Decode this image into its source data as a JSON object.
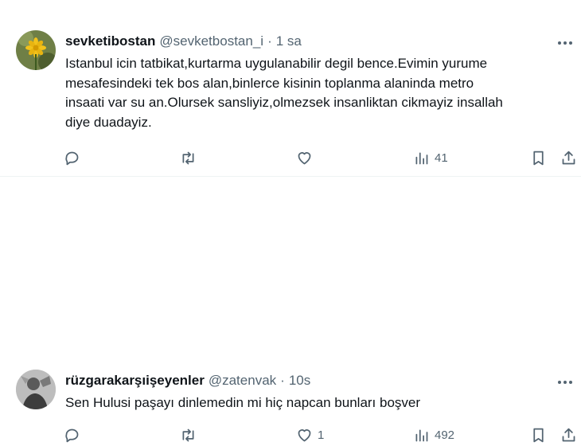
{
  "tweets": [
    {
      "display_name": "sevketibostan",
      "handle": "@sevketbostan_i",
      "sep": "·",
      "time": "1 sa",
      "lines": [
        "Istanbul icin tatbikat,kurtarma uygulanabilir degil bence.Evimin yurume",
        "mesafesindeki tek bos alan,binlerce kisinin toplanma alaninda metro",
        "insaati var su an.Olursek sansliyiz,olmezsek insanliktan cikmayiz insallah",
        "diye duadayiz."
      ],
      "likes": "",
      "views": "41"
    },
    {
      "display_name": "rüzgarakarşıişeyenler",
      "handle": "@zatenvak",
      "sep": "·",
      "time": "10s",
      "lines": [
        "Sen Hulusi paşayı dinlemedin mi hiç napcan bunları boşver"
      ],
      "likes": "1",
      "views": "492"
    }
  ],
  "icons": [
    "reply-icon",
    "retweet-icon",
    "like-icon",
    "views-icon",
    "bookmark-icon",
    "share-icon",
    "more-icon"
  ],
  "colors": {
    "text": "#0f1419",
    "muted": "#536471",
    "divider": "#eff3f4"
  }
}
